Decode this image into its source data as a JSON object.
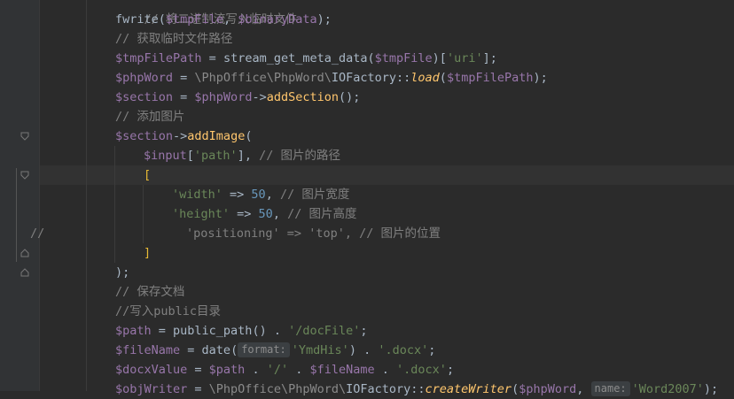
{
  "editor": {
    "lines": {
      "l0_comment": "// 将二进制流写入临时文件",
      "l1_func": "fwrite",
      "l1_arg1": "$tmpFile",
      "l1_arg2": "$binaryData",
      "l2_comment": "// 获取临时文件路径",
      "l3_var": "$tmpFilePath",
      "l3_func": "stream_get_meta_data",
      "l3_arg": "$tmpFile",
      "l3_key": "'uri'",
      "l4_var": "$phpWord",
      "l4_ns": "\\PhpOffice\\PhpWord\\",
      "l4_class": "IOFactory",
      "l4_method": "load",
      "l4_arg": "$tmpFilePath",
      "l5_var": "$section",
      "l5_obj": "$phpWord",
      "l5_method": "addSection",
      "l6_comment": "// 添加图片",
      "l7_obj": "$section",
      "l7_method": "addImage",
      "l8_var": "$input",
      "l8_key": "'path'",
      "l8_comment": "// 图片的路径",
      "l9_bracket": "[",
      "l10_key": "'width'",
      "l10_val": "50",
      "l10_comment": "// 图片宽度",
      "l11_key": "'height'",
      "l11_val": "50",
      "l11_comment": "// 图片高度",
      "l12_prefix": "//",
      "l12_key": "'positioning'",
      "l12_val": "'top'",
      "l12_comment": "// 图片的位置",
      "l13_bracket": "]",
      "l14_close": ");",
      "l15_comment": "// 保存文档",
      "l16_comment": "//写入public目录",
      "l17_var": "$path",
      "l17_func": "public_path",
      "l17_str": "'/docFile'",
      "l18_var": "$fileName",
      "l18_func": "date",
      "l18_hint": "format:",
      "l18_str": "'YmdHis'",
      "l18_ext": "'.docx'",
      "l19_var": "$docxValue",
      "l19_a": "$path",
      "l19_sep": "'/'",
      "l19_b": "$fileName",
      "l19_ext": "'.docx'",
      "l20_var": "$objWriter",
      "l20_ns": "\\PhpOffice\\PhpWord\\",
      "l20_class": "IOFactory",
      "l20_method": "createWriter",
      "l20_arg": "$phpWord",
      "l20_hint": "name:",
      "l20_str": "'Word2007'"
    }
  },
  "colors": {
    "background": "#2b2b2b",
    "variable": "#9876aa",
    "string": "#6a8759",
    "method": "#ffc66d",
    "number": "#6897bb",
    "comment": "#808080"
  }
}
